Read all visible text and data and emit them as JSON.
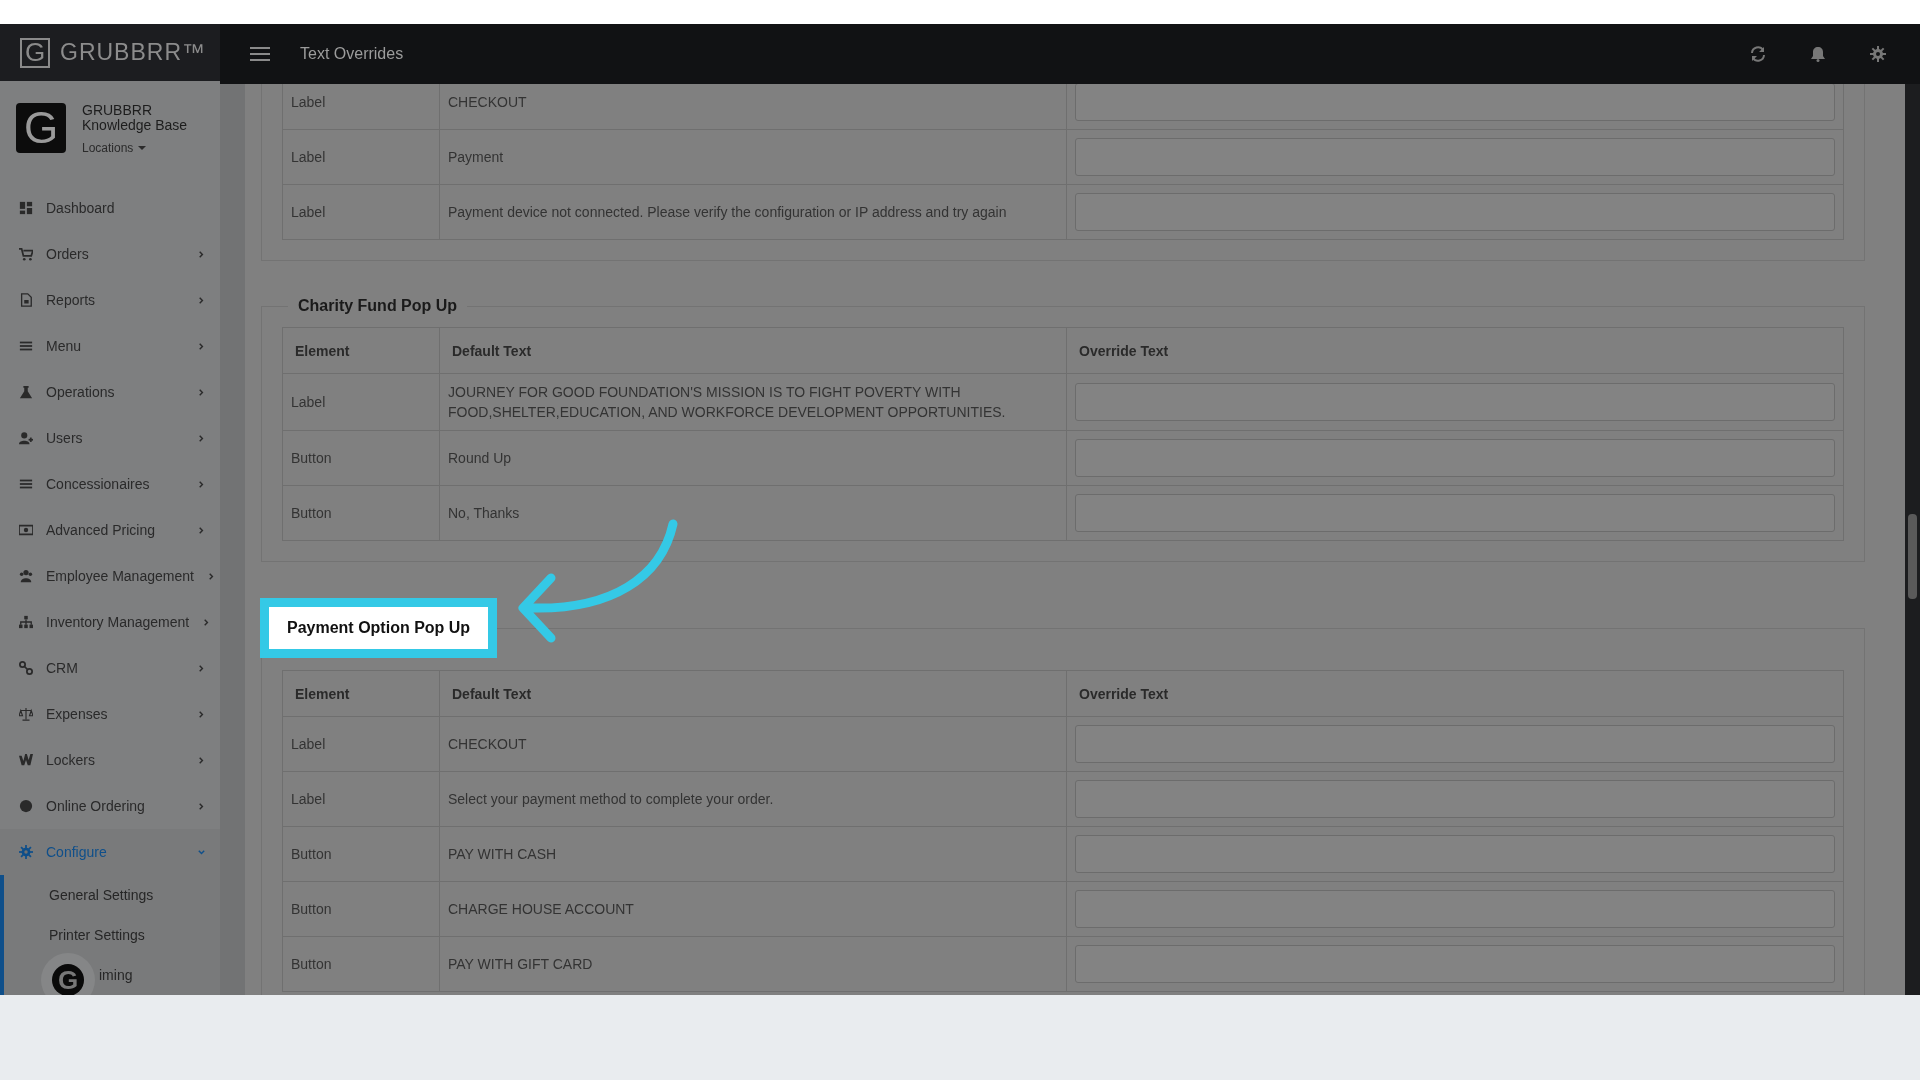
{
  "brand": {
    "logo_letter": "G",
    "name": "GRUBBRR™"
  },
  "page_title": "Text Overrides",
  "profile": {
    "letter": "G",
    "name": "GRUBBRR Knowledge Base",
    "locations": "Locations"
  },
  "sidebar": {
    "items": [
      {
        "label": "Dashboard",
        "has_arrow": false,
        "selected": false
      },
      {
        "label": "Orders",
        "has_arrow": true,
        "selected": false
      },
      {
        "label": "Reports",
        "has_arrow": true,
        "selected": false
      },
      {
        "label": "Menu",
        "has_arrow": true,
        "selected": false
      },
      {
        "label": "Operations",
        "has_arrow": true,
        "selected": false
      },
      {
        "label": "Users",
        "has_arrow": true,
        "selected": false
      },
      {
        "label": "Concessionaires",
        "has_arrow": true,
        "selected": false
      },
      {
        "label": "Advanced Pricing",
        "has_arrow": true,
        "selected": false
      },
      {
        "label": "Employee Management",
        "has_arrow": true,
        "selected": false
      },
      {
        "label": "Inventory Management",
        "has_arrow": true,
        "selected": false
      },
      {
        "label": "CRM",
        "has_arrow": true,
        "selected": false
      },
      {
        "label": "Expenses",
        "has_arrow": true,
        "selected": false
      },
      {
        "label": "Lockers",
        "has_arrow": true,
        "selected": false
      },
      {
        "label": "Online Ordering",
        "has_arrow": true,
        "selected": false
      },
      {
        "label": "Configure",
        "has_arrow": true,
        "selected": true,
        "expanded": true,
        "children": [
          {
            "label": "General Settings"
          },
          {
            "label": "Printer Settings"
          },
          {
            "label": "iming"
          }
        ]
      }
    ]
  },
  "chat_button": {
    "letter": "G"
  },
  "sections": [
    {
      "rows": [
        {
          "element": "Label",
          "default_text": "CHECKOUT"
        },
        {
          "element": "Label",
          "default_text": "Payment"
        },
        {
          "element": "Label",
          "default_text": "Payment device not connected. Please verify the configuration or IP address and try again"
        }
      ]
    },
    {
      "title": "Charity Fund Pop Up",
      "columns": [
        "Element",
        "Default Text",
        "Override Text"
      ],
      "rows": [
        {
          "element": "Label",
          "default_text": "JOURNEY FOR GOOD FOUNDATION'S MISSION IS TO FIGHT POVERTY WITH FOOD,SHELTER,EDUCATION, AND WORKFORCE DEVELOPMENT OPPORTUNITIES."
        },
        {
          "element": "Button",
          "default_text": "Round Up"
        },
        {
          "element": "Button",
          "default_text": "No, Thanks"
        }
      ]
    },
    {
      "title": "Payment Option Pop Up",
      "highlighted": true,
      "columns": [
        "Element",
        "Default Text",
        "Override Text"
      ],
      "rows": [
        {
          "element": "Label",
          "default_text": "CHECKOUT"
        },
        {
          "element": "Label",
          "default_text": "Select your payment method to complete your order."
        },
        {
          "element": "Button",
          "default_text": "PAY WITH CASH"
        },
        {
          "element": "Button",
          "default_text": "CHARGE HOUSE ACCOUNT"
        },
        {
          "element": "Button",
          "default_text": "PAY WITH GIFT CARD"
        }
      ]
    }
  ]
}
